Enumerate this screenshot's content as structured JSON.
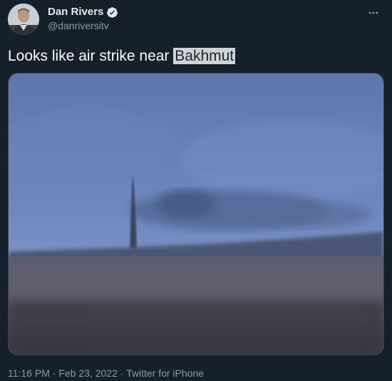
{
  "author": {
    "name": "Dan Rivers",
    "handle": "@danriversitv",
    "verified_icon": "verified-badge-icon",
    "avatar_icon": "avatar-photo"
  },
  "menu": {
    "icon": "more-dots-icon"
  },
  "tweet": {
    "text_before": "Looks like air strike near ",
    "highlighted_text": "Bakhmut"
  },
  "media": {
    "kind": "video-frame"
  },
  "meta": {
    "time": "11:16 PM",
    "sep1": " · ",
    "date": "Feb 23, 2022",
    "sep2": " · ",
    "source": "Twitter for iPhone"
  },
  "colors": {
    "background": "#15202b",
    "text_primary": "#e7e9ea",
    "text_secondary": "#8b98a5",
    "verified_badge": "#e7e9ea",
    "highlight": "#cfd3d6"
  }
}
